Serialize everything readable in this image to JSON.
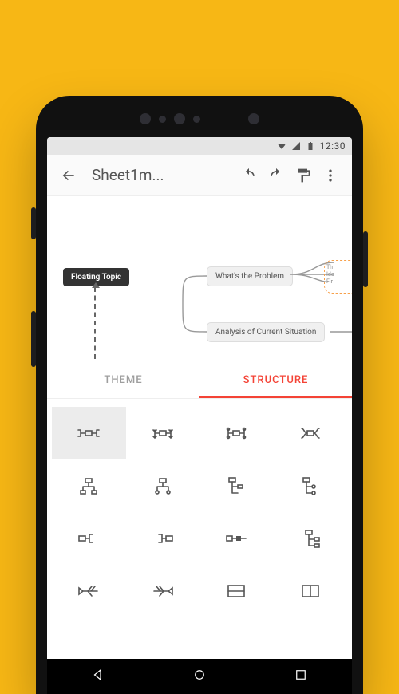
{
  "status": {
    "time": "12:30"
  },
  "appbar": {
    "title": "Sheet1m...",
    "back": "Back",
    "undo": "Undo",
    "redo": "Redo",
    "format": "Format",
    "more": "More"
  },
  "canvas": {
    "floating_topic": "Floating Topic",
    "node1": "What's the Problem",
    "node2": "Analysis of Current Situation",
    "side_lines": [
      "Th",
      "Ide",
      "Fir"
    ]
  },
  "tabs": {
    "theme": "THEME",
    "structure": "STRUCTURE",
    "active": "structure"
  },
  "structures": [
    {
      "name": "map-balanced",
      "selected": true
    },
    {
      "name": "map-clockwise"
    },
    {
      "name": "map-left-right"
    },
    {
      "name": "map-radial"
    },
    {
      "name": "org-down"
    },
    {
      "name": "org-up"
    },
    {
      "name": "tree-left"
    },
    {
      "name": "tree-right"
    },
    {
      "name": "logic-right"
    },
    {
      "name": "logic-left"
    },
    {
      "name": "timeline"
    },
    {
      "name": "tree-table"
    },
    {
      "name": "fishbone-left"
    },
    {
      "name": "fishbone-right"
    },
    {
      "name": "matrix-rows"
    },
    {
      "name": "matrix-cols"
    }
  ],
  "colors": {
    "accent": "#f44336",
    "bg": "#f7b715"
  }
}
